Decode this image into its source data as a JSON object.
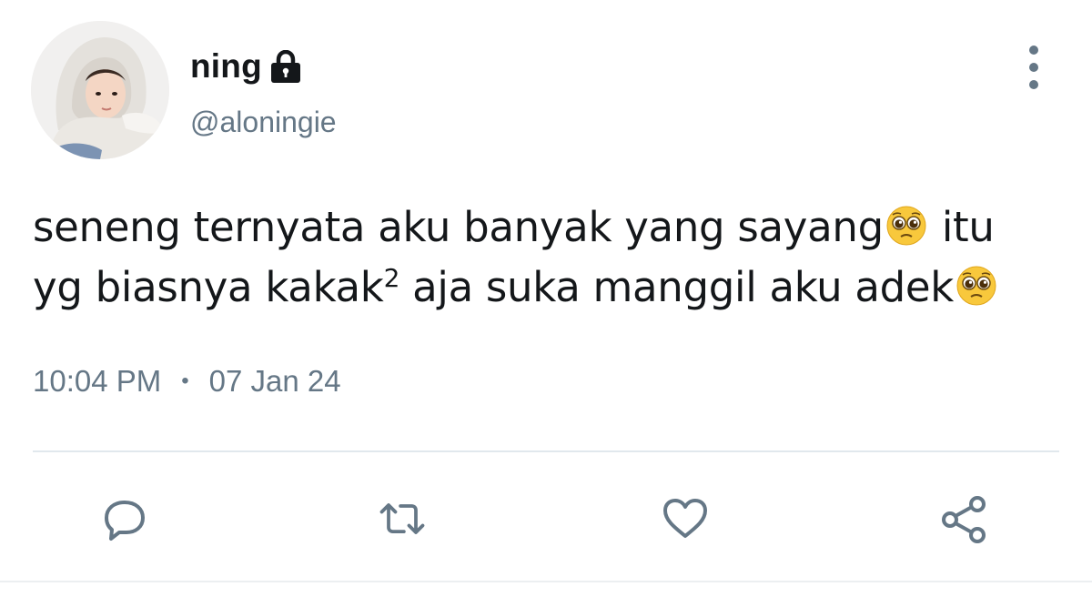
{
  "user": {
    "display_name": "ning",
    "handle": "@aloningie",
    "avatar_icon": "avatar-photo",
    "protected_icon": "lock-icon"
  },
  "tweet": {
    "line1_text": "seneng ternyata aku banyak yang sayang",
    "line1_end": "itu",
    "line2_text": "yg biasnya kakak",
    "line2_sup": "2",
    "line2_rest": " aja suka manggil aku adek",
    "emoji_icon": "pleading-face-emoji"
  },
  "meta": {
    "time": "10:04 PM",
    "separator": "•",
    "date": "07 Jan 24"
  },
  "actions": {
    "reply_icon": "reply-icon",
    "retweet_icon": "retweet-icon",
    "like_icon": "heart-icon",
    "share_icon": "share-icon",
    "more_icon": "more-vertical-icon"
  },
  "colors": {
    "primary_text": "#14171a",
    "secondary_text": "#657786",
    "divider": "#e1e8ed"
  }
}
